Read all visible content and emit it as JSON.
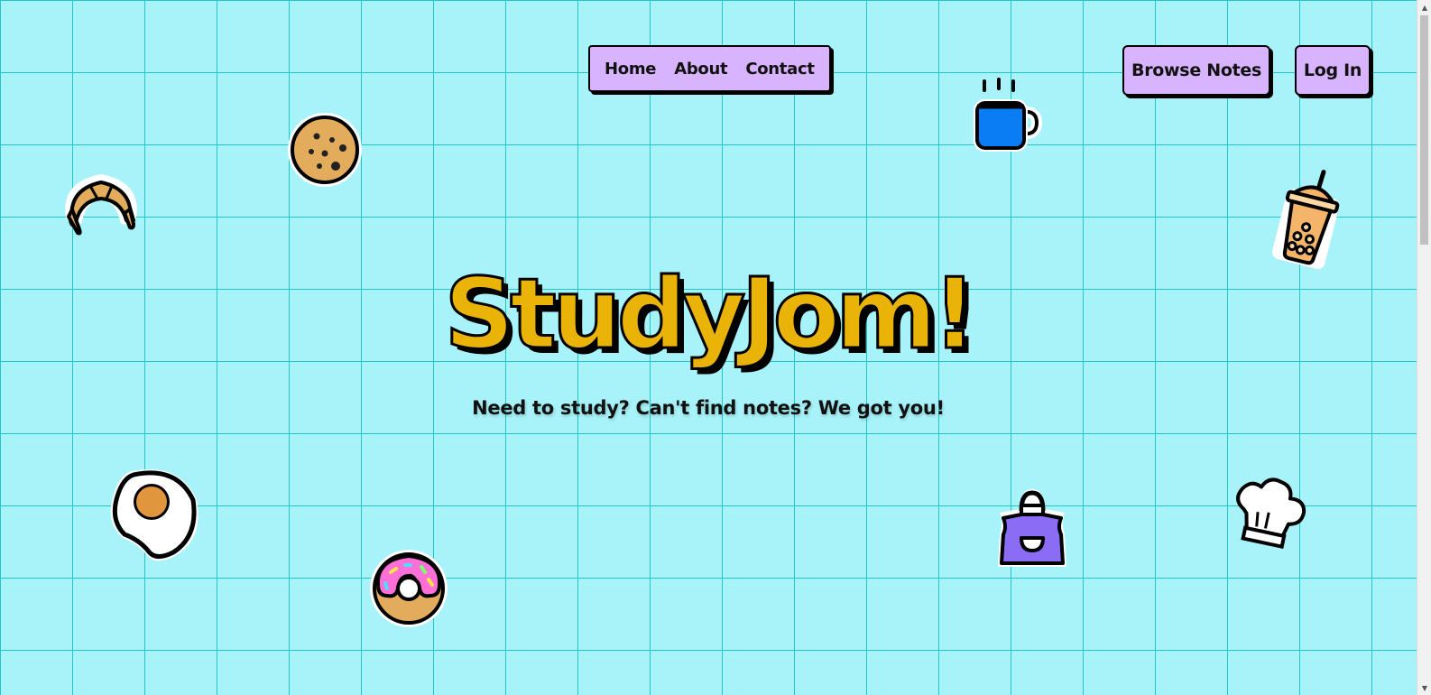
{
  "nav": {
    "links": [
      {
        "label": "Home"
      },
      {
        "label": "About"
      },
      {
        "label": "Contact"
      }
    ]
  },
  "actions": {
    "browse_label": "Browse Notes",
    "login_label": "Log In"
  },
  "hero": {
    "title": "StudyJom!",
    "subtitle": "Need to study? Can't find notes? We got you!"
  },
  "stickers": [
    {
      "name": "cookie-icon"
    },
    {
      "name": "croissant-icon"
    },
    {
      "name": "coffee-mug-icon"
    },
    {
      "name": "bubble-tea-icon"
    },
    {
      "name": "fried-egg-icon"
    },
    {
      "name": "donut-icon"
    },
    {
      "name": "apron-icon"
    },
    {
      "name": "chef-hat-icon"
    }
  ],
  "colors": {
    "background": "#a7f3f9",
    "grid": "#22c6c2",
    "button": "#d8b4fe",
    "title": "#eab308"
  }
}
